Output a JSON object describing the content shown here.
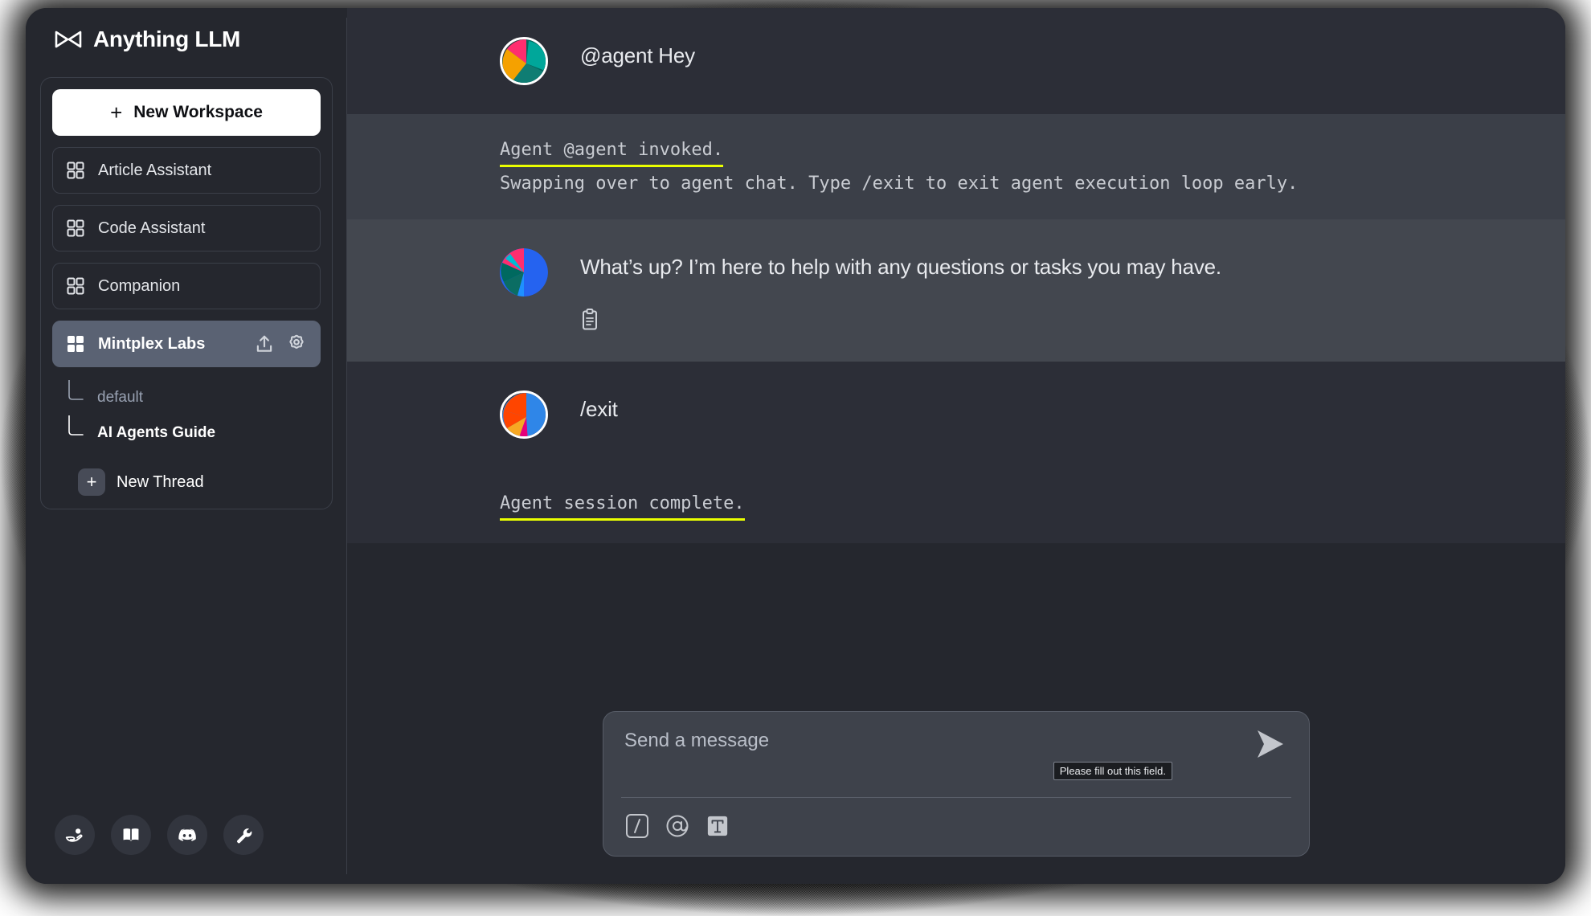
{
  "app": {
    "title": "Anything LLM",
    "logo_icon": "anythingllm-logo-icon"
  },
  "sidebar": {
    "new_workspace": {
      "label": "New Workspace",
      "plus": "+",
      "icon": "plus-icon"
    },
    "workspaces": [
      {
        "label": "Article Assistant",
        "icon": "grid-squares-icon",
        "active": false
      },
      {
        "label": "Code Assistant",
        "icon": "grid-squares-icon",
        "active": false
      },
      {
        "label": "Companion",
        "icon": "grid-squares-icon",
        "active": false
      },
      {
        "label": "Mintplex Labs",
        "icon": "grid-squares-filled-icon",
        "active": true
      }
    ],
    "active_workspace_actions": [
      {
        "name": "upload-icon"
      },
      {
        "name": "gear-icon"
      }
    ],
    "threads": [
      {
        "label": "default",
        "state": "muted"
      },
      {
        "label": "AI Agents Guide",
        "state": "strong"
      }
    ],
    "new_thread": {
      "label": "New Thread",
      "plus": "+",
      "icon": "plus-icon"
    },
    "footer_icons": [
      {
        "name": "hand-coin-icon",
        "title": "Support"
      },
      {
        "name": "book-open-icon",
        "title": "Docs"
      },
      {
        "name": "discord-icon",
        "title": "Discord"
      },
      {
        "name": "wrench-icon",
        "title": "Settings"
      }
    ]
  },
  "chat": {
    "messages": [
      {
        "kind": "user",
        "text": "@agent Hey",
        "avatar": "user-avatar-teal-orange"
      },
      {
        "kind": "system",
        "headline": "Agent @agent invoked.",
        "subline": "Swapping over to agent chat. Type /exit to exit agent execution loop early."
      },
      {
        "kind": "assistant",
        "text": "What’s up? I’m here to help with any questions or tasks you may have.",
        "avatar": "assistant-avatar-blue-pink",
        "actions": [
          {
            "name": "copy-icon"
          }
        ]
      },
      {
        "kind": "user",
        "text": "/exit",
        "avatar": "user-avatar-orange-blue"
      },
      {
        "kind": "system2",
        "headline": "Agent session complete.",
        "subline": ""
      }
    ]
  },
  "composer": {
    "placeholder": "Send a message",
    "value": "",
    "tooltip": "Please fill out this field.",
    "send_icon": "send-paper-plane-icon",
    "tools": [
      {
        "name": "slash-command-icon",
        "glyph": "/"
      },
      {
        "name": "at-mention-icon",
        "glyph": "@"
      },
      {
        "name": "text-prompt-icon",
        "glyph": "T"
      }
    ]
  },
  "colors": {
    "window_bg": "#25272e",
    "sidebar_bg": "#25272e",
    "active_item_bg": "#5a6273",
    "assistant_row_bg": "#43474f",
    "system_row_bg": "#3b3f48",
    "accent_yellow": "#eaff00",
    "composer_bg": "#3e424b",
    "text_primary": "#e8eaee",
    "text_muted": "#98a1b2"
  }
}
